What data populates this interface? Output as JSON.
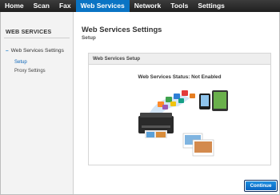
{
  "nav": {
    "tabs": [
      {
        "label": "Home",
        "active": false
      },
      {
        "label": "Scan",
        "active": false
      },
      {
        "label": "Fax",
        "active": false
      },
      {
        "label": "Web Services",
        "active": true
      },
      {
        "label": "Network",
        "active": false
      },
      {
        "label": "Tools",
        "active": false
      },
      {
        "label": "Settings",
        "active": false
      }
    ]
  },
  "sidebar": {
    "title": "WEB SERVICES",
    "section_marker": "–",
    "section_label": "Web Services Settings",
    "links": [
      {
        "label": "Setup",
        "current": true
      },
      {
        "label": "Proxy Settings",
        "current": false
      }
    ]
  },
  "main": {
    "title": "Web Services Settings",
    "subtitle": "Setup",
    "panel_header": "Web Services Setup",
    "status_text": "Web Services Status: Not Enabled",
    "continue_label": "Continue"
  },
  "colors": {
    "accent": "#0a74c4",
    "nav_bg": "#2b2b2b",
    "button": "#0a64c0"
  },
  "icons": [
    "printer-icon",
    "smartphone-icon",
    "tablet-icon",
    "photo-print-icon",
    "cloud-apps-icon"
  ]
}
